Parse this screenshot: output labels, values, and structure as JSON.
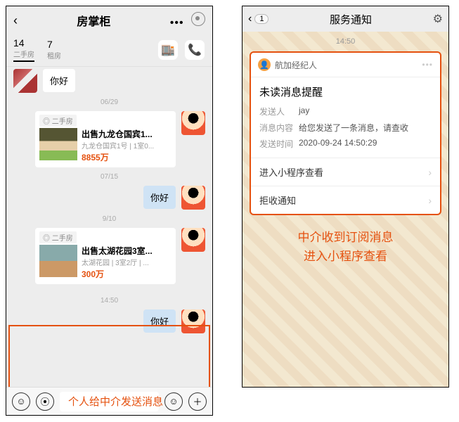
{
  "left": {
    "header": {
      "title": "房掌柜"
    },
    "tabs": [
      {
        "count": "14",
        "label": "二手房"
      },
      {
        "count": "7",
        "label": "租房"
      }
    ],
    "greeting": "你好",
    "dates": {
      "d1": "06/29",
      "d2": "07/15",
      "d3": "9/10",
      "d4": "14:50"
    },
    "card1": {
      "tag": "◎ 二手房",
      "title": "出售九龙仓国宾1...",
      "sub": "九龙仓国宾1号 | 1室0...",
      "price": "8855万"
    },
    "msg_hello": "你好",
    "card2": {
      "tag": "◎ 二手房",
      "title": "出售太湖花园3室...",
      "sub": "太湖花园 | 3室2厅 | ...",
      "price": "300万"
    },
    "caption": "个人给中介发送消息"
  },
  "right": {
    "header": {
      "back_count": "1",
      "title": "服务通知"
    },
    "time": "14:50",
    "notif": {
      "sender_name": "航加经纪人",
      "title": "未读消息提醒",
      "rows": {
        "sender_label": "发送人",
        "sender_val": "jay",
        "content_label": "消息内容",
        "content_val": "给您发送了一条消息，请查收",
        "time_label": "发送时间",
        "time_val": "2020-09-24 14:50:29"
      },
      "action1": "进入小程序查看",
      "action2": "拒收通知"
    },
    "caption_line1": "中介收到订阅消息",
    "caption_line2": "进入小程序查看"
  },
  "colors": {
    "accent": "#e5510f"
  }
}
